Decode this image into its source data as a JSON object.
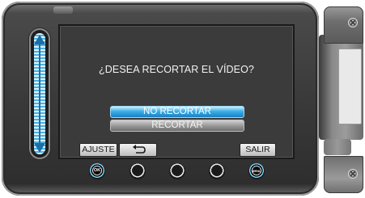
{
  "screen": {
    "prompt": "¿DESEA RECORTAR EL VÍDEO?",
    "options": [
      {
        "label": "NO RECORTAR",
        "selected": true
      },
      {
        "label": "RECORTAR",
        "selected": false
      }
    ],
    "softkeys": {
      "ajuste": "AJUSTE",
      "back_icon": "return-arrow-icon",
      "salir": "SALIR"
    }
  },
  "hardware_buttons": {
    "ok_label": "OK",
    "menu_label": "MENU"
  },
  "colors": {
    "selected_option": "#3aaee6",
    "slider_accent": "#4fb0e0",
    "screen_bg": "#3b3b3b"
  }
}
